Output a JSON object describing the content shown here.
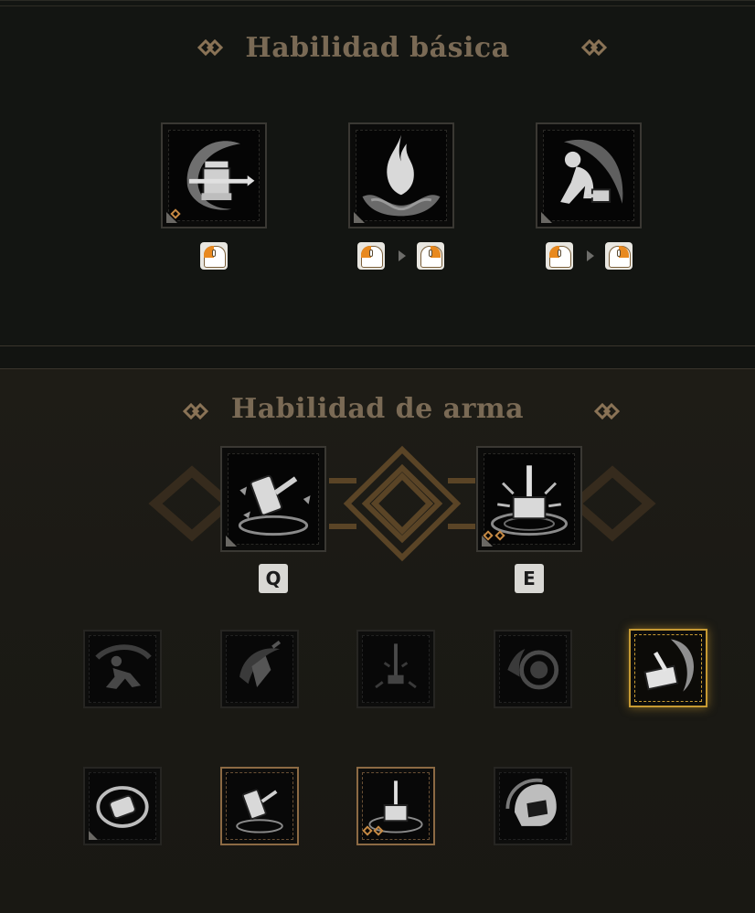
{
  "basic_skills": {
    "title": "Habilidad básica",
    "slots": [
      {
        "icon": "hammer-swing-icon",
        "input": [
          "left-click"
        ]
      },
      {
        "icon": "flame-icon",
        "input": [
          "left-click",
          "left-click"
        ]
      },
      {
        "icon": "crouch-strike-icon",
        "input": [
          "left-click",
          "left-click"
        ]
      }
    ]
  },
  "weapon_skills": {
    "title": "Habilidad de arma",
    "equipped": [
      {
        "icon": "hammer-throw-icon",
        "key": "Q"
      },
      {
        "icon": "hammer-slam-icon",
        "key": "E"
      }
    ],
    "options": [
      {
        "icon": "dash-icon",
        "state": "locked"
      },
      {
        "icon": "crystal-slash-icon",
        "state": "locked"
      },
      {
        "icon": "sword-drop-icon",
        "state": "locked"
      },
      {
        "icon": "shield-bash-icon",
        "state": "locked"
      },
      {
        "icon": "hammer-spin-icon",
        "state": "selected"
      },
      {
        "icon": "roll-hammer-icon",
        "state": "available"
      },
      {
        "icon": "hammer-throw-icon",
        "state": "equipped"
      },
      {
        "icon": "hammer-slam-icon",
        "state": "equipped"
      },
      {
        "icon": "helmet-icon",
        "state": "available"
      }
    ]
  },
  "colors": {
    "title": "#7a6a55",
    "accent": "#e8891f",
    "selected_border": "#c79a33",
    "equipped_border": "#8c6a44"
  }
}
